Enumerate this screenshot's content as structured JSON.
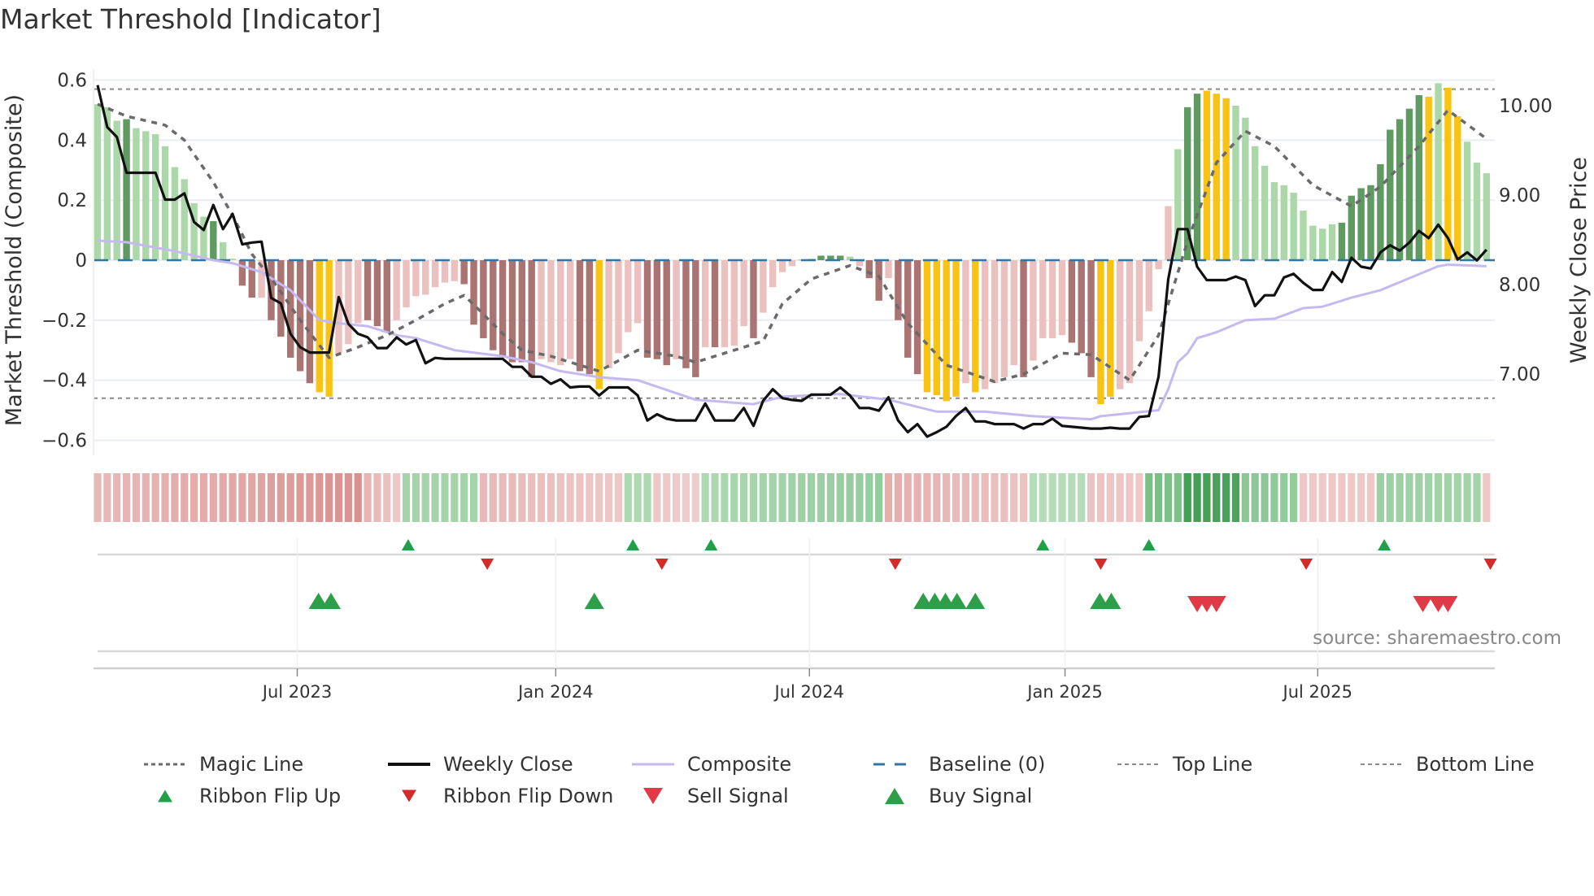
{
  "title": "Market Threshold [Indicator]",
  "colors": {
    "light_green": "#acd8a9",
    "dark_green": "#5f9a62",
    "light_red": "#ebc1bf",
    "dark_red": "#a97472",
    "extreme": "#f8c312",
    "magic": "#6a6a6a",
    "close": "#111111",
    "composite": "#c5b9f0",
    "baseline": "#2f76a6",
    "threshold": "#8a8a8a",
    "grid": "#e9ecf3",
    "buy": "#2e9e48",
    "sell": "#df3a45",
    "flip_up": "#21a048",
    "flip_down": "#d42a2a"
  },
  "chart_data": {
    "type": "bar",
    "title": "Market Threshold [Indicator]",
    "ylabel": "Market Threshold (Composite)",
    "y2label": "Weekly Close Price",
    "ylim": [
      -0.65,
      0.62
    ],
    "y2lim": [
      5.9,
      10.3
    ],
    "x_unit": "week index",
    "yticks": [
      {
        "label": "0.6",
        "value": 0.6
      },
      {
        "label": "0.4",
        "value": 0.4
      },
      {
        "label": "0.2",
        "value": 0.2
      },
      {
        "label": "0",
        "value": 0
      },
      {
        "label": "−0.2",
        "value": -0.2
      },
      {
        "label": "−0.4",
        "value": -0.4
      },
      {
        "label": "−0.6",
        "value": -0.6
      }
    ],
    "y2ticks": [
      {
        "label": "10.00",
        "value": 10
      },
      {
        "label": "9.00",
        "value": 9
      },
      {
        "label": "8.00",
        "value": 8
      },
      {
        "label": "7.00",
        "value": 7
      }
    ],
    "xticks": [
      {
        "label": "Jul 2023",
        "week": 20.7
      },
      {
        "label": "Jan 2024",
        "week": 47.5
      },
      {
        "label": "Jul 2024",
        "week": 73.8
      },
      {
        "label": "Jan 2025",
        "week": 100.3
      },
      {
        "label": "Jul 2025",
        "week": 126.5
      }
    ],
    "top_line": 0.57,
    "bottom_line": -0.46,
    "baseline": 0,
    "composite_bars": [
      0.52,
      0.51,
      0.465,
      0.47,
      0.44,
      0.43,
      0.42,
      0.38,
      0.31,
      0.27,
      0.19,
      0.145,
      0.13,
      0.06,
      0.005,
      -0.085,
      -0.125,
      -0.125,
      -0.2,
      -0.255,
      -0.325,
      -0.37,
      -0.41,
      -0.44,
      -0.455,
      -0.31,
      -0.28,
      -0.21,
      -0.2,
      -0.22,
      -0.24,
      -0.2,
      -0.157,
      -0.12,
      -0.115,
      -0.09,
      -0.075,
      -0.07,
      -0.08,
      -0.215,
      -0.26,
      -0.3,
      -0.32,
      -0.34,
      -0.34,
      -0.39,
      -0.33,
      -0.34,
      -0.35,
      -0.33,
      -0.37,
      -0.38,
      -0.43,
      -0.36,
      -0.31,
      -0.24,
      -0.21,
      -0.325,
      -0.33,
      -0.35,
      -0.33,
      -0.36,
      -0.39,
      -0.29,
      -0.29,
      -0.29,
      -0.285,
      -0.22,
      -0.26,
      -0.175,
      -0.09,
      -0.04,
      -0.02,
      0.003,
      0.005,
      0.015,
      0.015,
      0.015,
      0.012,
      -0.02,
      -0.06,
      -0.135,
      -0.06,
      -0.2,
      -0.325,
      -0.38,
      -0.44,
      -0.45,
      -0.47,
      -0.455,
      -0.41,
      -0.44,
      -0.43,
      -0.41,
      -0.39,
      -0.35,
      -0.39,
      -0.335,
      -0.26,
      -0.26,
      -0.25,
      -0.275,
      -0.31,
      -0.39,
      -0.48,
      -0.455,
      -0.43,
      -0.41,
      -0.27,
      -0.17,
      -0.03,
      0.18,
      0.37,
      0.51,
      0.555,
      0.565,
      0.555,
      0.54,
      0.515,
      0.475,
      0.38,
      0.315,
      0.26,
      0.25,
      0.225,
      0.165,
      0.115,
      0.105,
      0.12,
      0.125,
      0.215,
      0.24,
      0.25,
      0.32,
      0.435,
      0.47,
      0.505,
      0.55,
      0.545,
      0.59,
      0.575,
      0.48,
      0.395,
      0.325,
      0.29
    ],
    "bar_classes": "LLLGLLLLLLLLGLLRRPRRRRRYYPPPRRRPPPPPPPRRRRRRRRPPPPRRYPPPPRRRPRRPRPPPRPPPPLLGGGLPRRPRRRYYYYPYPPPPRPPPPRRRYYPPPPPPLGGYYYLLLLLLLLLLLGGGGGGGGGYLYYLLLL",
    "bar_class_legend": {
      "L": "light_green",
      "G": "dark_green",
      "P": "light_red",
      "R": "dark_red",
      "Y": "extreme"
    },
    "weekly_close": [
      10.23,
      9.76,
      9.65,
      9.25,
      9.25,
      9.25,
      9.25,
      8.95,
      8.95,
      9.02,
      8.7,
      8.61,
      8.89,
      8.62,
      8.79,
      8.45,
      8.47,
      8.48,
      7.85,
      7.79,
      7.45,
      7.3,
      7.24,
      7.24,
      7.24,
      7.86,
      7.56,
      7.45,
      7.41,
      7.29,
      7.29,
      7.41,
      7.33,
      7.38,
      7.12,
      7.18,
      7.17,
      7.17,
      7.17,
      7.17,
      7.17,
      7.17,
      7.17,
      7.08,
      7.08,
      6.97,
      6.97,
      6.89,
      6.94,
      6.85,
      6.86,
      6.86,
      6.76,
      6.85,
      6.85,
      6.85,
      6.76,
      6.48,
      6.55,
      6.5,
      6.48,
      6.48,
      6.48,
      6.67,
      6.48,
      6.48,
      6.48,
      6.62,
      6.42,
      6.7,
      6.83,
      6.73,
      6.71,
      6.7,
      6.77,
      6.77,
      6.77,
      6.85,
      6.76,
      6.62,
      6.62,
      6.59,
      6.74,
      6.48,
      6.35,
      6.44,
      6.3,
      6.35,
      6.41,
      6.53,
      6.62,
      6.47,
      6.47,
      6.44,
      6.44,
      6.44,
      6.39,
      6.44,
      6.44,
      6.5,
      6.42,
      6.41,
      6.4,
      6.39,
      6.39,
      6.4,
      6.39,
      6.39,
      6.52,
      6.53,
      6.97,
      8.06,
      8.62,
      8.62,
      8.2,
      8.05,
      8.05,
      8.05,
      8.09,
      8.05,
      7.76,
      7.88,
      7.88,
      8.08,
      8.12,
      8.02,
      7.94,
      7.94,
      8.14,
      8.03,
      8.3,
      8.2,
      8.18,
      8.36,
      8.44,
      8.38,
      8.47,
      8.6,
      8.52,
      8.67,
      8.52,
      8.28,
      8.36,
      8.27,
      8.39
    ],
    "magic_line": [
      [
        0,
        0.52
      ],
      [
        3,
        0.48
      ],
      [
        7,
        0.45
      ],
      [
        9,
        0.4
      ],
      [
        12,
        0.26
      ],
      [
        14,
        0.15
      ],
      [
        16,
        0.02
      ],
      [
        18,
        -0.06
      ],
      [
        21,
        -0.2
      ],
      [
        24,
        -0.325
      ],
      [
        27,
        -0.29
      ],
      [
        30,
        -0.25
      ],
      [
        33,
        -0.2
      ],
      [
        36,
        -0.145
      ],
      [
        38,
        -0.117
      ],
      [
        40,
        -0.18
      ],
      [
        42,
        -0.245
      ],
      [
        44,
        -0.3
      ],
      [
        47,
        -0.32
      ],
      [
        52,
        -0.37
      ],
      [
        56,
        -0.3
      ],
      [
        60,
        -0.32
      ],
      [
        62,
        -0.34
      ],
      [
        66,
        -0.3
      ],
      [
        69,
        -0.27
      ],
      [
        71,
        -0.145
      ],
      [
        74,
        -0.063
      ],
      [
        78,
        -0.018
      ],
      [
        81,
        -0.054
      ],
      [
        84,
        -0.21
      ],
      [
        88,
        -0.35
      ],
      [
        93,
        -0.405
      ],
      [
        96,
        -0.38
      ],
      [
        100,
        -0.31
      ],
      [
        103,
        -0.315
      ],
      [
        107,
        -0.4
      ],
      [
        110,
        -0.25
      ],
      [
        113,
        0.063
      ],
      [
        116,
        0.325
      ],
      [
        119,
        0.43
      ],
      [
        122,
        0.38
      ],
      [
        126,
        0.25
      ],
      [
        130,
        0.18
      ],
      [
        133,
        0.245
      ],
      [
        137,
        0.38
      ],
      [
        140,
        0.5
      ],
      [
        144,
        0.405
      ]
    ],
    "composite_line": [
      [
        0,
        0.065
      ],
      [
        3,
        0.06
      ],
      [
        8,
        0.03
      ],
      [
        12,
        0
      ],
      [
        14,
        -0.01
      ],
      [
        17,
        -0.04
      ],
      [
        20,
        -0.1
      ],
      [
        23,
        -0.2
      ],
      [
        25,
        -0.21
      ],
      [
        28,
        -0.22
      ],
      [
        31,
        -0.25
      ],
      [
        33,
        -0.26
      ],
      [
        37,
        -0.3
      ],
      [
        42,
        -0.32
      ],
      [
        45,
        -0.34
      ],
      [
        48,
        -0.37
      ],
      [
        52,
        -0.39
      ],
      [
        56,
        -0.4
      ],
      [
        62,
        -0.465
      ],
      [
        68,
        -0.48
      ],
      [
        71,
        -0.455
      ],
      [
        77,
        -0.446
      ],
      [
        82,
        -0.465
      ],
      [
        87,
        -0.505
      ],
      [
        92,
        -0.505
      ],
      [
        97,
        -0.52
      ],
      [
        103,
        -0.53
      ],
      [
        104,
        -0.52
      ],
      [
        110,
        -0.5
      ],
      [
        111,
        -0.43
      ],
      [
        112,
        -0.34
      ],
      [
        113,
        -0.31
      ],
      [
        114,
        -0.26
      ],
      [
        116,
        -0.24
      ],
      [
        119,
        -0.2
      ],
      [
        122,
        -0.195
      ],
      [
        125,
        -0.16
      ],
      [
        127,
        -0.155
      ],
      [
        130,
        -0.125
      ],
      [
        133,
        -0.1
      ],
      [
        136,
        -0.06
      ],
      [
        139,
        -0.02
      ],
      [
        140,
        -0.015
      ],
      [
        144,
        -0.02
      ]
    ],
    "ribbon": [
      {
        "from": 0,
        "to": 17,
        "start": -0.35,
        "end": -0.55
      },
      {
        "from": 18,
        "to": 27,
        "start": -0.6,
        "end": -0.75
      },
      {
        "from": 28,
        "to": 31,
        "start": -0.4,
        "end": -0.2
      },
      {
        "from": 32,
        "to": 39,
        "start": 0.3,
        "end": 0.3
      },
      {
        "from": 40,
        "to": 54,
        "start": -0.35,
        "end": -0.2
      },
      {
        "from": 55,
        "to": 57,
        "start": 0.25,
        "end": 0.25
      },
      {
        "from": 58,
        "to": 62,
        "start": -0.2,
        "end": -0.15
      },
      {
        "from": 63,
        "to": 81,
        "start": 0.25,
        "end": 0.4
      },
      {
        "from": 82,
        "to": 96,
        "start": -0.45,
        "end": -0.25
      },
      {
        "from": 97,
        "to": 102,
        "start": 0.2,
        "end": 0.2
      },
      {
        "from": 103,
        "to": 108,
        "start": -0.25,
        "end": -0.2
      },
      {
        "from": 109,
        "to": 124,
        "start": 0.55,
        "end": 0.4
      },
      {
        "from": 113,
        "to": 118,
        "start": 0.9,
        "end": 0.85
      },
      {
        "from": 125,
        "to": 132,
        "start": -0.2,
        "end": -0.2
      },
      {
        "from": 133,
        "to": 143,
        "start": 0.35,
        "end": 0.3
      },
      {
        "from": 144,
        "to": 144,
        "start": -0.2,
        "end": -0.2
      }
    ],
    "ribbon_flip_up": [
      32.2,
      55.5,
      63.6,
      98,
      109,
      133.4
    ],
    "ribbon_flip_down": [
      40.4,
      58.5,
      82.7,
      104,
      125.3,
      144.4
    ],
    "buy_signal": [
      22.9,
      24.2,
      51.5,
      85.6,
      86.8,
      87.9,
      89.1,
      91,
      103.9,
      105.1
    ],
    "sell_signal": [
      114,
      115,
      116,
      137.4,
      139,
      140
    ]
  },
  "source": "source: sharemaestro.com",
  "legend": [
    {
      "label": "Magic Line",
      "type": "dotted",
      "color": "#6a6a6a"
    },
    {
      "label": "Weekly Close",
      "type": "solid",
      "color": "#111111"
    },
    {
      "label": "Composite",
      "type": "solid-light",
      "color": "#c5b9f0"
    },
    {
      "label": "Baseline (0)",
      "type": "dashed",
      "color": "#2f76a6"
    },
    {
      "label": "Top Line",
      "type": "dotted-thin",
      "color": "#8a8a8a"
    },
    {
      "label": "Bottom Line",
      "type": "dotted-thin",
      "color": "#8a8a8a"
    },
    {
      "label": "Ribbon Flip Up",
      "type": "tri-up-small",
      "color": "#21a048"
    },
    {
      "label": "Ribbon Flip Down",
      "type": "tri-down-small",
      "color": "#d42a2a"
    },
    {
      "label": "Sell Signal",
      "type": "tri-down",
      "color": "#df3a45"
    },
    {
      "label": "Buy Signal",
      "type": "tri-up",
      "color": "#2e9e48"
    }
  ]
}
